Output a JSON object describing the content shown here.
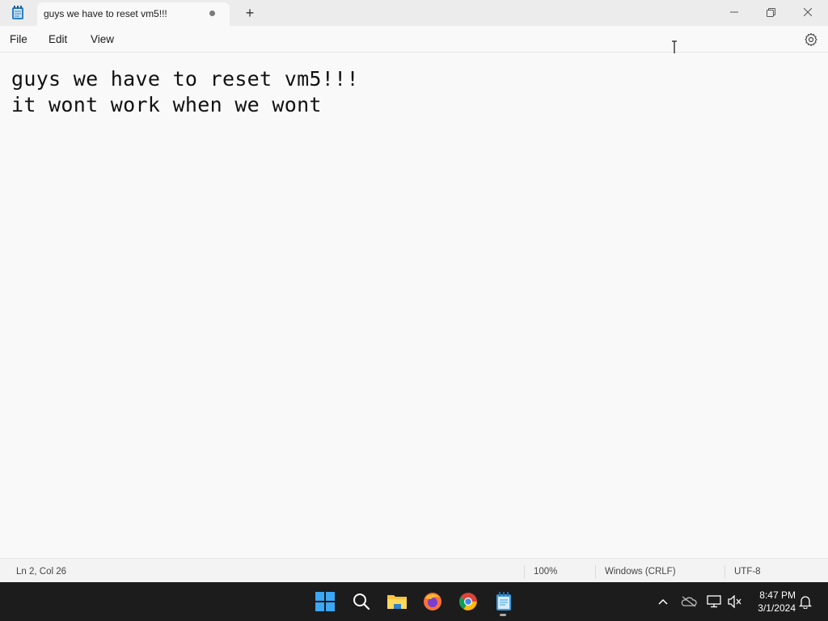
{
  "window": {
    "app_icon": "notepad-icon",
    "tab_title": "guys we have to reset vm5!!!",
    "tab_modified_indicator": "unsaved-dot",
    "new_tab_label": "+",
    "controls": [
      "minimize-icon",
      "maximize-icon",
      "close-icon"
    ]
  },
  "menu": {
    "items": [
      "File",
      "Edit",
      "View"
    ],
    "settings_icon": "gear-icon"
  },
  "editor": {
    "lines": [
      "guys we have to reset vm5!!!",
      "it wont work when we wont"
    ]
  },
  "status": {
    "position": "Ln 2, Col 26",
    "zoom": "100%",
    "line_ending": "Windows (CRLF)",
    "encoding": "UTF-8"
  },
  "taskbar": {
    "apps": [
      "start-icon",
      "search-icon",
      "file-explorer-icon",
      "firefox-icon",
      "chrome-icon",
      "notepad-icon"
    ],
    "tray": [
      "chevron-up-icon",
      "onedrive-icon",
      "network-icon",
      "volume-muted-icon",
      "notification-bell-icon"
    ],
    "time": "8:47 PM",
    "date": "3/1/2024"
  },
  "colors": {
    "accent": "#0078d4",
    "taskbar_bg": "#1c1c1c",
    "window_bg": "#f9f9f9"
  }
}
